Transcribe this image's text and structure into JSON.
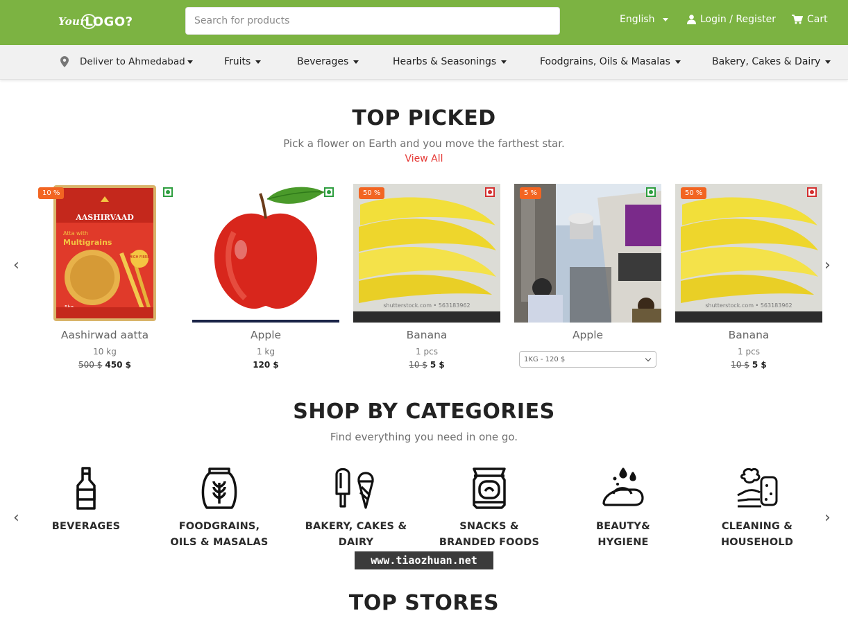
{
  "header": {
    "logo_text": "YourLOGO?",
    "search_placeholder": "Search for products",
    "language": "English",
    "login": "Login / Register",
    "cart": "Cart"
  },
  "nav": {
    "deliver": "Deliver to Ahmedabad",
    "items": [
      "Fruits",
      "Beverages",
      "Hearbs & Seasonings",
      "Foodgrains, Oils & Masalas",
      "Bakery, Cakes & Dairy"
    ]
  },
  "top_picked": {
    "title": "TOP PICKED",
    "subtitle": "Pick a flower on Earth and you move the farthest star.",
    "view_all": "View All",
    "products": [
      {
        "name": "Aashirwad aatta",
        "qty": "10 kg",
        "old_price": "500 $",
        "price": "450 $",
        "badge": "10 %",
        "marker": "veg"
      },
      {
        "name": "Apple",
        "qty": "1 kg",
        "old_price": "",
        "price": "120 $",
        "badge": "",
        "marker": "veg"
      },
      {
        "name": "Banana",
        "qty": "1 pcs",
        "old_price": "10 $",
        "price": "5 $",
        "badge": "50 %",
        "marker": "non-veg"
      },
      {
        "name": "Apple",
        "option": "1KG  -  120 $",
        "badge": "5 %",
        "marker": "veg"
      },
      {
        "name": "Banana",
        "qty": "1 pcs",
        "old_price": "10 $",
        "price": "5 $",
        "badge": "50 %",
        "marker": "non-veg"
      }
    ],
    "packaging": {
      "brand": "AASHIRVAAD",
      "line1": "Atta with",
      "line2": "Multigrains",
      "tag": "HIGH FIBRE",
      "weight": "5kg"
    },
    "watermark_text": "shutterstock.com • 563183962"
  },
  "categories": {
    "title": "SHOP BY CATEGORIES",
    "subtitle": "Find everything you need in one go.",
    "items": [
      {
        "label": "BEVERAGES",
        "icon": "bottle-icon"
      },
      {
        "label": "FOODGRAINS,\nOILS & MASALAS",
        "icon": "grain-jar-icon"
      },
      {
        "label": "BAKERY,  CAKES &\nDAIRY",
        "icon": "ice-cream-icon"
      },
      {
        "label": "SNACKS &\nBRANDED FOODS",
        "icon": "snack-pack-icon"
      },
      {
        "label": "BEAUTY&\nHYGIENE",
        "icon": "soap-icon"
      },
      {
        "label": "CLEANING &\nHOUSEHOLD",
        "icon": "cleaning-sponge-icon"
      }
    ]
  },
  "top_stores": {
    "title": "TOP STORES"
  },
  "overlay": {
    "watermark": "www.tiaozhuan.net"
  },
  "colors": {
    "brand_green": "#7cb342",
    "accent_red": "#e53935",
    "badge_orange": "#f26522"
  }
}
